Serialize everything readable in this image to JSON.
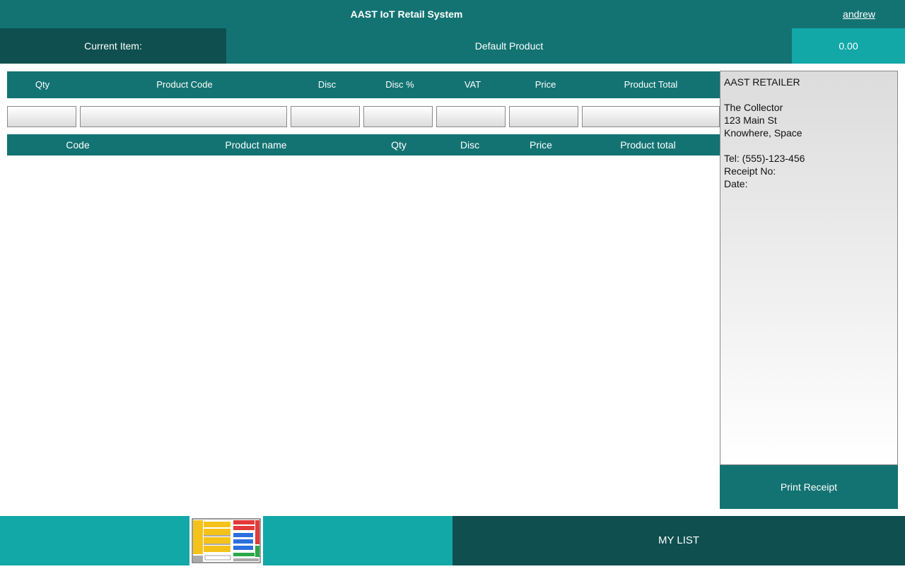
{
  "header": {
    "title": "AAST IoT Retail System",
    "user": "andrew"
  },
  "current_item": {
    "label": "Current Item:",
    "name": "Default Product",
    "price": "0.00"
  },
  "entry_table": {
    "headers": [
      "Qty",
      "Product Code",
      "Disc",
      "Disc %",
      "VAT",
      "Price",
      "Product Total"
    ],
    "values": [
      "",
      "",
      "",
      "",
      "",
      "",
      ""
    ]
  },
  "items_table": {
    "headers": [
      "Code",
      "Product name",
      "Qty",
      "Disc",
      "Price",
      "Product total"
    ],
    "rows": []
  },
  "receipt": {
    "store": "AAST RETAILER",
    "line1": "The Collector",
    "line2": "123 Main St",
    "line3": "Knowhere, Space",
    "tel": "Tel: (555)-123-456",
    "receipt_no": "Receipt No:",
    "date": "Date:"
  },
  "buttons": {
    "print_receipt": "Print Receipt",
    "my_list": "MY LIST"
  },
  "icons": {
    "store_map": "store-map-thumbnail"
  },
  "colors": {
    "primary": "#137373",
    "dark": "#0f4f4f",
    "accent": "#12a8a8"
  }
}
